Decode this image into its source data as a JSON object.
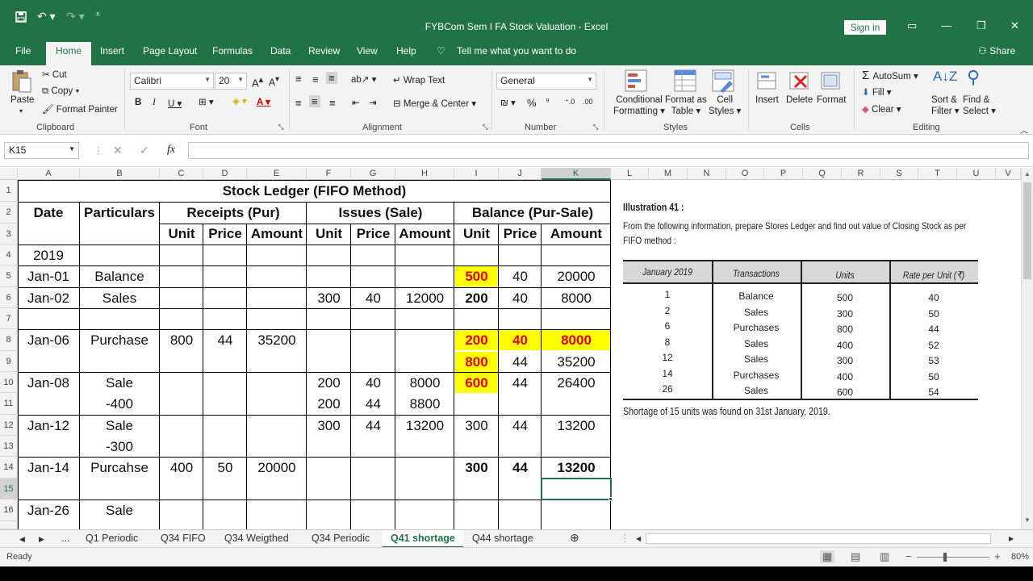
{
  "window": {
    "title": "FYBCom Sem I FA Stock Valuation  -  Excel",
    "sign_in": "Sign in",
    "share": "Share"
  },
  "tabs": [
    "File",
    "Home",
    "Insert",
    "Page Layout",
    "Formulas",
    "Data",
    "Review",
    "View",
    "Help"
  ],
  "tell_me": "Tell me what you want to do",
  "ribbon": {
    "paste": "Paste",
    "cut": "Cut",
    "copy": "Copy",
    "format_painter": "Format Painter",
    "clipboard": "Clipboard",
    "font_name": "Calibri",
    "font_size": "20",
    "font": "Font",
    "wrap_text": "Wrap Text",
    "merge_center": "Merge & Center",
    "alignment": "Alignment",
    "number_format": "General",
    "number": "Number",
    "cond_fmt1": "Conditional",
    "cond_fmt2": "Formatting",
    "fmt_table1": "Format as",
    "fmt_table2": "Table",
    "cell_styles1": "Cell",
    "cell_styles2": "Styles",
    "styles": "Styles",
    "insert": "Insert",
    "delete": "Delete",
    "format": "Format",
    "cells": "Cells",
    "autosum": "AutoSum",
    "fill": "Fill",
    "clear": "Clear",
    "sort1": "Sort &",
    "sort2": "Filter",
    "find1": "Find &",
    "find2": "Select",
    "editing": "Editing"
  },
  "namebox": "K15",
  "columns": [
    "A",
    "B",
    "C",
    "D",
    "E",
    "F",
    "G",
    "H",
    "I",
    "J",
    "K",
    "L",
    "M",
    "N",
    "O",
    "P",
    "Q",
    "R",
    "S",
    "T",
    "U",
    "V"
  ],
  "rows": [
    "1",
    "2",
    "3",
    "4",
    "5",
    "6",
    "7",
    "8",
    "9",
    "10",
    "11",
    "12",
    "13",
    "14",
    "15",
    "16"
  ],
  "ledger": {
    "title": "Stock Ledger (FIFO Method)",
    "h_date": "Date",
    "h_particulars": "Particulars",
    "h_receipts": "Receipts (Pur)",
    "h_issues": "Issues (Sale)",
    "h_balance": "Balance (Pur-Sale)",
    "h_unit": "Unit",
    "h_price": "Price",
    "h_amount": "Amount",
    "year": "2019",
    "r5": {
      "date": "Jan-01",
      "part": "Balance",
      "bu": "500",
      "bp": "40",
      "ba": "20000"
    },
    "r6": {
      "date": "Jan-02",
      "part": "Sales",
      "iu": "300",
      "ip": "40",
      "ia": "12000",
      "bu": "200",
      "bp": "40",
      "ba": "8000"
    },
    "r8": {
      "date": "Jan-06",
      "part": "Purchase",
      "ru": "800",
      "rp": "44",
      "ra": "35200",
      "bu": "200",
      "bp": "40",
      "ba": "8000"
    },
    "r9": {
      "bu": "800",
      "bp": "44",
      "ba": "35200"
    },
    "r10": {
      "date": "Jan-08",
      "part": "Sale",
      "iu": "200",
      "ip": "40",
      "ia": "8000",
      "bu": "600",
      "bp": "44",
      "ba": "26400"
    },
    "r11": {
      "part": "-400",
      "iu": "200",
      "ip": "44",
      "ia": "8800"
    },
    "r12": {
      "date": "Jan-12",
      "part": "Sale",
      "iu": "300",
      "ip": "44",
      "ia": "13200",
      "bu": "300",
      "bp": "44",
      "ba": "13200"
    },
    "r13": {
      "part": "-300"
    },
    "r14": {
      "date": "Jan-14",
      "part": "Purcahse",
      "ru": "400",
      "rp": "50",
      "ra": "20000",
      "bu": "300",
      "bp": "44",
      "ba": "13200"
    },
    "r16": {
      "date": "Jan-26",
      "part": "Sale"
    }
  },
  "illustration": {
    "title": "Illustration 41 :",
    "question": "From the following information, prepare Stores Ledger and find out value of Closing Stock as per",
    "question2": "FIFO method :",
    "headers": [
      "January 2019",
      "Transactions",
      "Units",
      "Rate per Unit (₹)"
    ],
    "rows": [
      [
        "1",
        "Balance",
        "500",
        "40"
      ],
      [
        "2",
        "Sales",
        "300",
        "50"
      ],
      [
        "6",
        "Purchases",
        "800",
        "44"
      ],
      [
        "8",
        "Sales",
        "400",
        "52"
      ],
      [
        "12",
        "Sales",
        "300",
        "53"
      ],
      [
        "14",
        "Purchases",
        "400",
        "50"
      ],
      [
        "26",
        "Sales",
        "600",
        "54"
      ]
    ],
    "note": "Shortage of 15 units was found on 31st January, 2019."
  },
  "sheet_tabs": [
    "Q1 Periodic",
    "Q34 FIFO",
    "Q34 Weigthed",
    "Q34 Periodic",
    "Q41 shortage",
    "Q44 shortage"
  ],
  "active_sheet": "Q41 shortage",
  "status": {
    "ready": "Ready",
    "zoom": "80%"
  }
}
